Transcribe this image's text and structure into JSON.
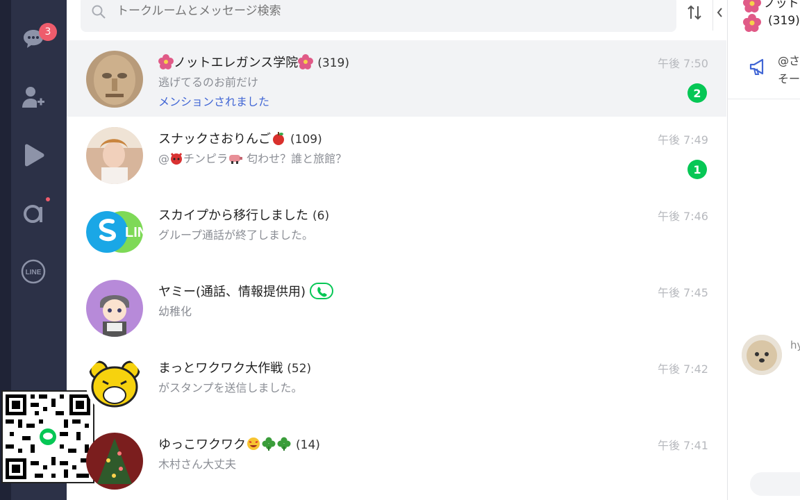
{
  "sidebar": {
    "chats_badge": "3",
    "icons": [
      "chat-icon",
      "add-friend-icon",
      "play-icon",
      "openchat-icon",
      "line-icon"
    ]
  },
  "line_logo_text": "LINE",
  "search": {
    "placeholder": "トークルームとメッセージ検索"
  },
  "chats": [
    {
      "name": "ノットエレガンス学院",
      "count": "(319)",
      "message": "逃げてるのお前だけ",
      "mention": "メンションされました",
      "time": "午後 7:50",
      "unread": "2"
    },
    {
      "name": "スナックさおりんご",
      "count": "(109)",
      "message_prefix": "@",
      "message_mid": "チンピラ",
      "message": "匂わせ？誰と旅館？",
      "time": "午後 7:49",
      "unread": "1"
    },
    {
      "name": "スカイプから移行しました",
      "count": "(6)",
      "message": "グループ通話が終了しました。",
      "time": "午後 7:46"
    },
    {
      "name": "ヤミー(通話、情報提供用)",
      "message": "幼稚化",
      "time": "午後 7:45"
    },
    {
      "name": "まっとワクワク大作戦",
      "count": "(52)",
      "message": "がスタンプを送信しました。",
      "time": "午後 7:42"
    },
    {
      "name": "ゆっこワクワク",
      "count": "(14)",
      "message": "木村さん大丈夫",
      "time": "午後 7:41"
    }
  ],
  "skype_avatar_text": "LIN",
  "right_panel": {
    "title_partial": "ノットエ",
    "count_partial": "(319)",
    "announcement_line1": "@さ",
    "announcement_line2": "そー",
    "message_sender_partial": "hy"
  },
  "colors": {
    "sidebar": "#2c3147",
    "unread_badge": "#06c755",
    "notification_badge": "#ee5c6c",
    "mention": "#4166d5"
  }
}
